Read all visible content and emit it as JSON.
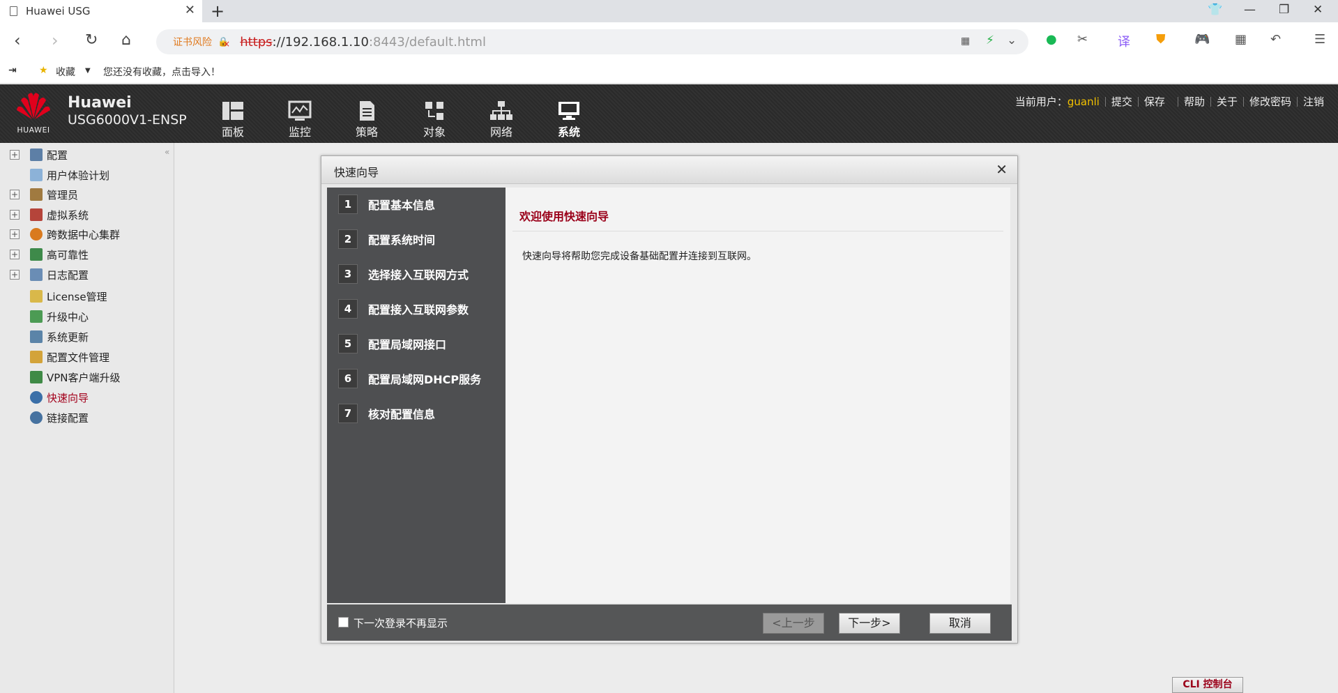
{
  "browser": {
    "tab_title": "Huawei USG",
    "tab_close": "✕",
    "new_tab": "+",
    "cert_warning": "证书风险",
    "url_scheme": "https",
    "url_host": "://192.168.1.10",
    "url_rest": ":8443/default.html",
    "bookmarks_label": "收藏",
    "bookmarks_hint": "您还没有收藏，点击导入！"
  },
  "header": {
    "logo_text": "HUAWEI",
    "brand": "Huawei",
    "model": "USG6000V1-ENSP",
    "nav": [
      {
        "label": "面板",
        "icon": "dashboard-icon"
      },
      {
        "label": "监控",
        "icon": "monitor-icon"
      },
      {
        "label": "策略",
        "icon": "policy-icon"
      },
      {
        "label": "对象",
        "icon": "object-icon"
      },
      {
        "label": "网络",
        "icon": "network-icon"
      },
      {
        "label": "系统",
        "icon": "system-icon"
      }
    ],
    "current_user_label": "当前用户：",
    "current_user": "guanli",
    "links": {
      "submit": "提交",
      "save": "保存",
      "help": "帮助",
      "about": "关于",
      "change_password": "修改密码",
      "logout": "注销"
    }
  },
  "sidebar": {
    "items": [
      {
        "label": "配置",
        "expandable": true
      },
      {
        "label": "用户体验计划",
        "expandable": false
      },
      {
        "label": "管理员",
        "expandable": true
      },
      {
        "label": "虚拟系统",
        "expandable": true
      },
      {
        "label": "跨数据中心集群",
        "expandable": true
      },
      {
        "label": "高可靠性",
        "expandable": true
      },
      {
        "label": "日志配置",
        "expandable": true
      },
      {
        "label": "License管理",
        "expandable": false
      },
      {
        "label": "升级中心",
        "expandable": false
      },
      {
        "label": "系统更新",
        "expandable": false
      },
      {
        "label": "配置文件管理",
        "expandable": false
      },
      {
        "label": "VPN客户端升级",
        "expandable": false
      },
      {
        "label": "快速向导",
        "expandable": false,
        "active": true
      },
      {
        "label": "链接配置",
        "expandable": false
      }
    ],
    "expand_symbol": "+"
  },
  "wizard": {
    "title": "快速向导",
    "close": "✕",
    "steps": [
      {
        "num": "1",
        "label": "配置基本信息"
      },
      {
        "num": "2",
        "label": "配置系统时间"
      },
      {
        "num": "3",
        "label": "选择接入互联网方式"
      },
      {
        "num": "4",
        "label": "配置接入互联网参数"
      },
      {
        "num": "5",
        "label": "配置局域网接口"
      },
      {
        "num": "6",
        "label": "配置局域网DHCP服务"
      },
      {
        "num": "7",
        "label": "核对配置信息"
      }
    ],
    "content_title": "欢迎使用快速向导",
    "content_text": "快速向导将帮助您完成设备基础配置并连接到互联网。",
    "dont_show_label": "下一次登录不再显示",
    "prev": "<上一步",
    "next": "下一步>",
    "cancel": "取消"
  },
  "cli_console": "CLI 控制台",
  "colors": {
    "accent": "#9a0019",
    "username": "#f2c100",
    "header_bg": "#2c2c2c"
  }
}
